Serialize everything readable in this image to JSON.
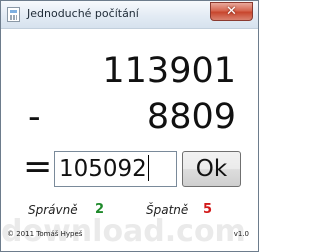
{
  "window": {
    "title": "Jednoduché počítání",
    "close_symbol": "✕"
  },
  "problem": {
    "first_number": "113901",
    "operator": "-",
    "second_number": "8809",
    "equals": "="
  },
  "answer": {
    "value": "105092"
  },
  "ok_button": {
    "label": "Ok"
  },
  "stats": {
    "correct_label": "Správně",
    "correct_count": "2",
    "wrong_label": "Špatně",
    "wrong_count": "5"
  },
  "footer": {
    "copyright": "© 2011 Tomáš Hypeš",
    "version": "v1.0"
  },
  "watermark": "download.com",
  "colors": {
    "correct": "#1f8a2b",
    "wrong": "#d21a1a",
    "close_button": "#d35f48"
  },
  "icons": {
    "app": "app-icon",
    "close": "close-icon"
  }
}
